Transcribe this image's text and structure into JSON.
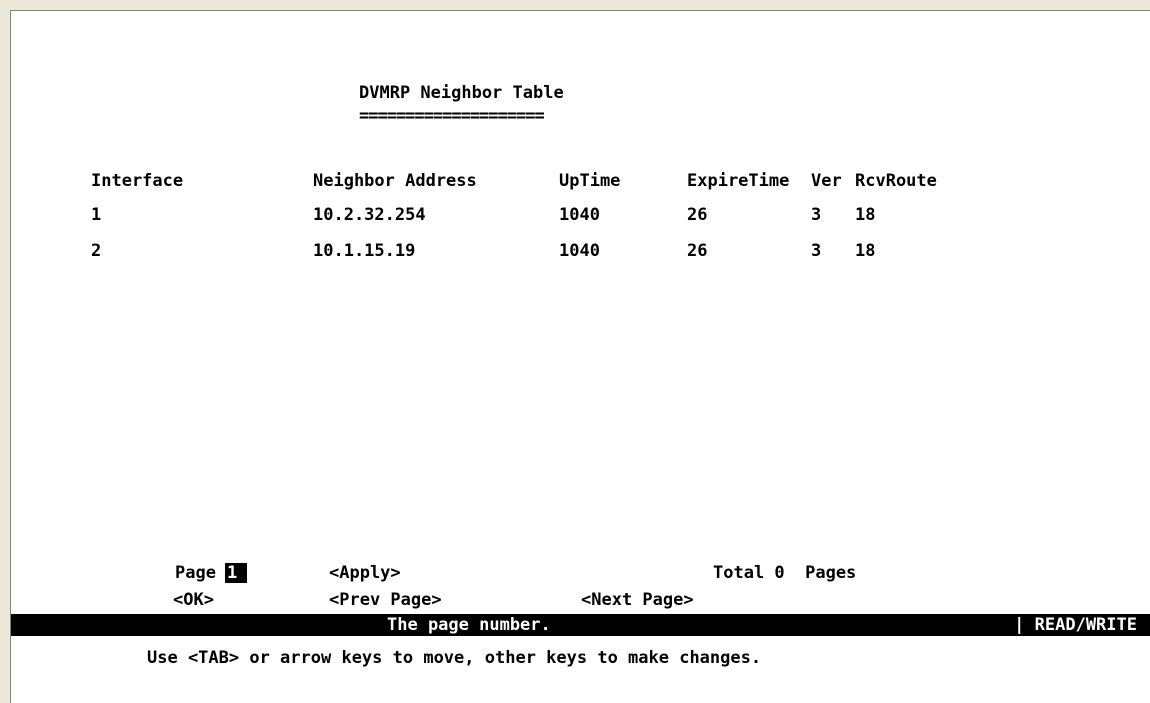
{
  "screen": {
    "title": "DVMRP Neighbor Table",
    "title_underline": "===================="
  },
  "table": {
    "headers": {
      "interface": "Interface",
      "neighbor_address": "Neighbor Address",
      "uptime": "UpTime",
      "expire_time": "ExpireTime",
      "ver": "Ver",
      "rcv_route": "RcvRoute"
    },
    "rows": [
      {
        "interface": "1",
        "neighbor_address": "10.2.32.254",
        "uptime": "1040",
        "expire_time": "26",
        "ver": "3",
        "rcv_route": "18"
      },
      {
        "interface": "2",
        "neighbor_address": "10.1.15.19",
        "uptime": "1040",
        "expire_time": "26",
        "ver": "3",
        "rcv_route": "18"
      }
    ]
  },
  "paging": {
    "page_label": "Page",
    "page_value": "1",
    "apply": "<Apply>",
    "total": "Total 0  Pages",
    "ok": "<OK>",
    "prev_page": "<Prev Page>",
    "next_page": "<Next Page>"
  },
  "status": {
    "message": "The page number.",
    "mode": "| READ/WRITE"
  },
  "help": "Use <TAB> or arrow keys to move, other keys to make changes.",
  "colors": {
    "background": "#ffffff",
    "text": "#000000",
    "statusbar": "#000000",
    "statusbar_text": "#ffffff"
  }
}
